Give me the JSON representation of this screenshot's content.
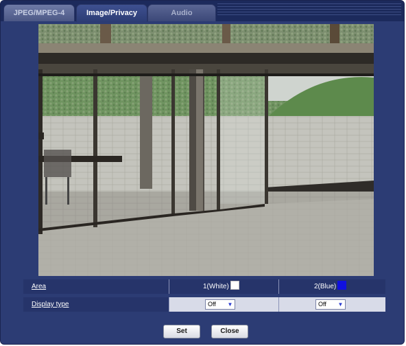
{
  "tabs": [
    {
      "label": "JPEG/MPEG-4"
    },
    {
      "label": "Image/Privacy",
      "active": true
    },
    {
      "label": "Audio"
    }
  ],
  "camera_view": {
    "description_icon": "camera-preview"
  },
  "privacy": {
    "area_label": "Area",
    "area1": "1(White)",
    "area2": "2(Blue)",
    "area1_color": "#ffffff",
    "area2_color": "#1010e0",
    "display_type_label": "Display type",
    "display_type1": "Off",
    "display_type2": "Off"
  },
  "buttons": {
    "set": "Set",
    "close": "Close"
  },
  "colors": {
    "panel": "#2c3c74",
    "header_row": "#26346a"
  }
}
